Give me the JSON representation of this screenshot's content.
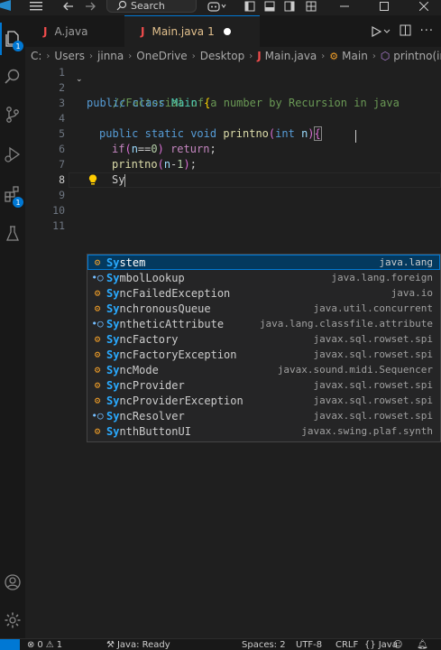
{
  "titlebar": {
    "search_label": "Search"
  },
  "activity": {
    "explorer_badge": "1",
    "extensions_badge": "1"
  },
  "tabs": [
    {
      "label": "A.java",
      "active": false
    },
    {
      "label": "Main.java",
      "problems": "1",
      "active": true
    }
  ],
  "breadcrumb": {
    "drive": "C:",
    "parts": [
      "Users",
      "jinna",
      "OneDrive",
      "Desktop"
    ],
    "file": "Main.java",
    "class": "Main",
    "method": "printno(int)"
  },
  "editor": {
    "line_numbers": [
      "1",
      "2",
      "3",
      "4",
      "5",
      "6",
      "7",
      "8",
      "9",
      "10",
      "11"
    ],
    "current_line": "8",
    "line2": "//Factorial of a number by Recursion in java",
    "line3_kw1": "public",
    "line3_kw2": "class",
    "line3_name": "Main",
    "line3_brace": "{",
    "line5_kw1": "public",
    "line5_kw2": "static",
    "line5_kw3": "void",
    "line5_fn": "printno",
    "line5_type": "int",
    "line5_param": "n",
    "line5_brace": "{",
    "line6_kw": "if",
    "line6_var": "n",
    "line6_op": "==",
    "line6_num": "0",
    "line6_ret": "return",
    "line6_end": ";",
    "line7_fn": "printno",
    "line7_var": "n",
    "line7_op": "-",
    "line7_num": "1",
    "line7_end": ";",
    "line8_text": "Sy"
  },
  "suggestions": [
    {
      "kind": "class",
      "match": "Sy",
      "rest": "stem",
      "detail": "java.lang",
      "selected": true
    },
    {
      "kind": "interface",
      "match": "Sy",
      "rest": "mbolLookup",
      "detail": "java.lang.foreign"
    },
    {
      "kind": "class",
      "match": "Sy",
      "rest": "ncFailedException",
      "detail": "java.io"
    },
    {
      "kind": "class",
      "match": "Sy",
      "rest": "nchronousQueue",
      "detail": "java.util.concurrent"
    },
    {
      "kind": "interface",
      "match": "Sy",
      "rest": "ntheticAttribute",
      "detail": "java.lang.classfile.attribute"
    },
    {
      "kind": "class",
      "match": "Sy",
      "rest": "ncFactory",
      "detail": "javax.sql.rowset.spi"
    },
    {
      "kind": "class",
      "match": "Sy",
      "rest": "ncFactoryException",
      "detail": "javax.sql.rowset.spi"
    },
    {
      "kind": "class",
      "match": "Sy",
      "rest": "ncMode",
      "detail": "javax.sound.midi.Sequencer"
    },
    {
      "kind": "class",
      "match": "Sy",
      "rest": "ncProvider",
      "detail": "javax.sql.rowset.spi"
    },
    {
      "kind": "class",
      "match": "Sy",
      "rest": "ncProviderException",
      "detail": "javax.sql.rowset.spi"
    },
    {
      "kind": "interface",
      "match": "Sy",
      "rest": "ncResolver",
      "detail": "javax.sql.rowset.spi"
    },
    {
      "kind": "class",
      "match": "Sy",
      "rest": "nthButtonUI",
      "detail": "javax.swing.plaf.synth"
    }
  ],
  "statusbar": {
    "errors": "0",
    "warnings": "1",
    "java_status": "Java: Ready",
    "spaces": "Spaces: 2",
    "encoding": "UTF-8",
    "eol": "CRLF",
    "language": "Java"
  },
  "colors": {
    "accent": "#0078d4",
    "editor_bg": "#1f1f1f",
    "suggest_selected": "#04395e",
    "match_highlight": "#2aaaff"
  }
}
